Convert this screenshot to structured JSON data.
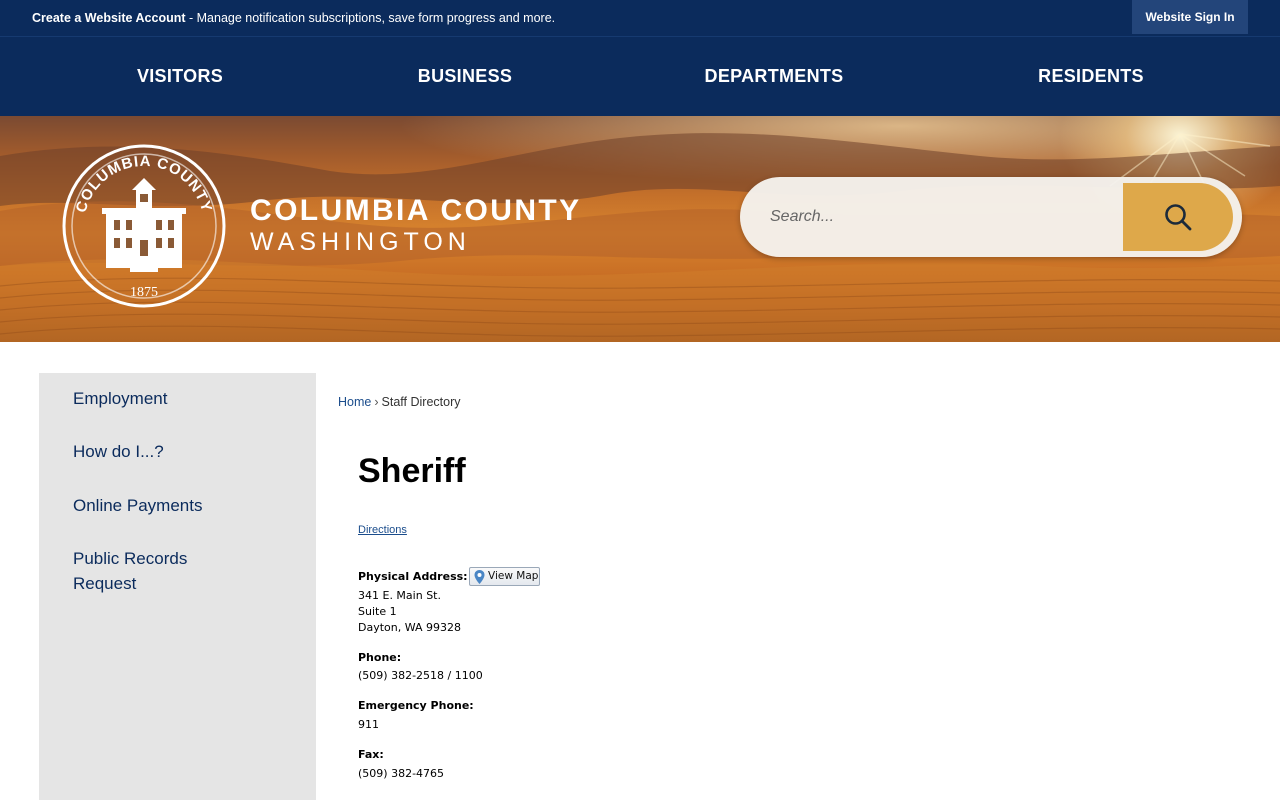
{
  "topbar": {
    "account_link": "Create a Website Account",
    "message": " - Manage notification subscriptions, save form progress and more.",
    "sign_in": "Website Sign In"
  },
  "nav": {
    "items": [
      {
        "label": "VISITORS"
      },
      {
        "label": "BUSINESS"
      },
      {
        "label": "DEPARTMENTS"
      },
      {
        "label": "RESIDENTS"
      }
    ]
  },
  "brand": {
    "seal_top_text": "COLUMBIA COUNTY",
    "seal_year": "1875",
    "line1": "COLUMBIA COUNTY",
    "line2": "WASHINGTON"
  },
  "search": {
    "placeholder": "Search...",
    "icon": "search-icon"
  },
  "sidebar": {
    "items": [
      {
        "label": "Employment"
      },
      {
        "label": "How do I...?"
      },
      {
        "label": "Online Payments"
      },
      {
        "label": "Public Records Request"
      }
    ]
  },
  "breadcrumb": {
    "home": "Home",
    "separator": "›",
    "current": "Staff Directory"
  },
  "page": {
    "title": "Sheriff",
    "directions": "Directions",
    "physical_address_label": "Physical Address:",
    "view_map": "View Map",
    "address_line1": "341 E. Main St.",
    "address_line2": "Suite 1",
    "address_line3": "Dayton, WA 99328",
    "phone_label": "Phone:",
    "phone": "(509) 382-2518 / 1100",
    "emergency_label": "Emergency Phone:",
    "emergency": "911",
    "fax_label": "Fax:",
    "fax": "(509) 382-4765"
  },
  "colors": {
    "nav_bg": "#0b2b5c",
    "accent_gold": "#dea84a",
    "sidebar_bg": "#e5e5e5",
    "link_blue": "#1b4d8c"
  }
}
